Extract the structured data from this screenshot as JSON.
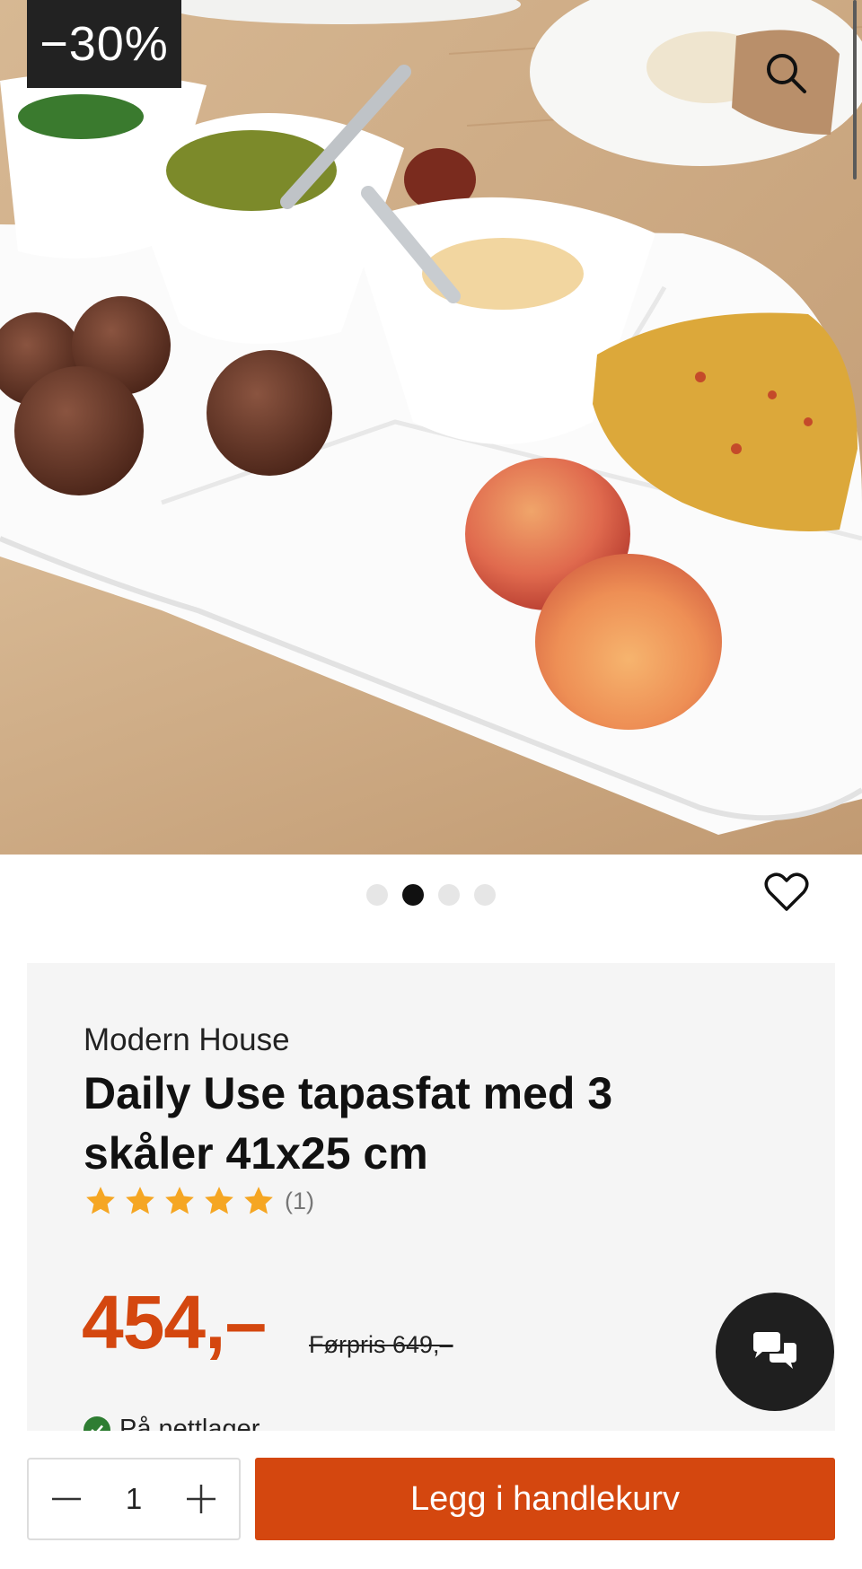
{
  "badge": {
    "discount": "−30%"
  },
  "gallery": {
    "total": 4,
    "active_index": 1
  },
  "product": {
    "brand": "Modern House",
    "title": "Daily Use tapasfat med 3 skåler 41x25 cm",
    "rating": {
      "stars": 5,
      "max": 5,
      "count_label": "(1)"
    },
    "price": "454,–",
    "old_price": "Førpris 649,–",
    "stock_label": "På nettlager"
  },
  "cart": {
    "quantity": "1",
    "add_label": "Legg i handlekurv"
  },
  "colors": {
    "accent": "#d4470f",
    "star": "#f5a623",
    "badge_bg": "#222222",
    "stock_ok": "#2e7d32"
  },
  "icons": [
    "search-icon",
    "heart-icon",
    "star-icon",
    "chat-icon",
    "minus-icon",
    "plus-icon",
    "check-icon"
  ]
}
